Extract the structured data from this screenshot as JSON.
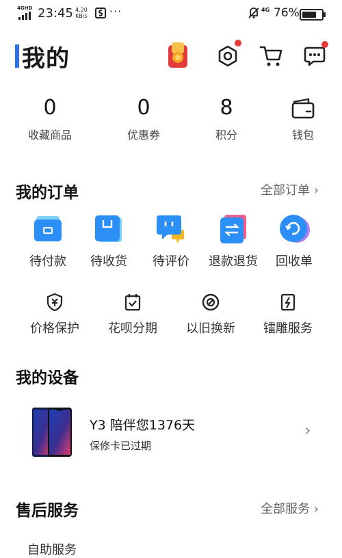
{
  "status_bar": {
    "network": "4G",
    "network_hd": "HD",
    "time": "23:45",
    "speed_value": "4.20",
    "speed_unit": "KB/s",
    "signal_label": "4G",
    "battery": "76%"
  },
  "header": {
    "title": "我的"
  },
  "stats": [
    {
      "value": "0",
      "label": "收藏商品"
    },
    {
      "value": "0",
      "label": "优惠券"
    },
    {
      "value": "8",
      "label": "积分"
    },
    {
      "value": "",
      "label": "钱包"
    }
  ],
  "orders": {
    "title": "我的订单",
    "all_label": "全部订单",
    "items": [
      {
        "label": "待付款",
        "icon": "wallet-card-icon"
      },
      {
        "label": "待收货",
        "icon": "box-icon"
      },
      {
        "label": "待评价",
        "icon": "chat-bubble-icon"
      },
      {
        "label": "退款退货",
        "icon": "exchange-icon"
      },
      {
        "label": "回收单",
        "icon": "recycle-icon"
      }
    ],
    "services": [
      {
        "label": "价格保护",
        "icon": "shield-yuan-icon"
      },
      {
        "label": "花呗分期",
        "icon": "calendar-check-icon"
      },
      {
        "label": "以旧换新",
        "icon": "circle-slash-icon"
      },
      {
        "label": "镭雕服务",
        "icon": "lightning-icon"
      }
    ]
  },
  "devices": {
    "title": "我的设备",
    "device_name": "Y3 陪伴您1376天",
    "warranty": "保修卡已过期"
  },
  "after_sales": {
    "title": "售后服务",
    "all_label": "全部服务",
    "partial_item": "自助服务"
  },
  "colors": {
    "accent": "#2f6fe6",
    "badge": "#e93a3a",
    "icon_blue": "#2b8ff5"
  }
}
